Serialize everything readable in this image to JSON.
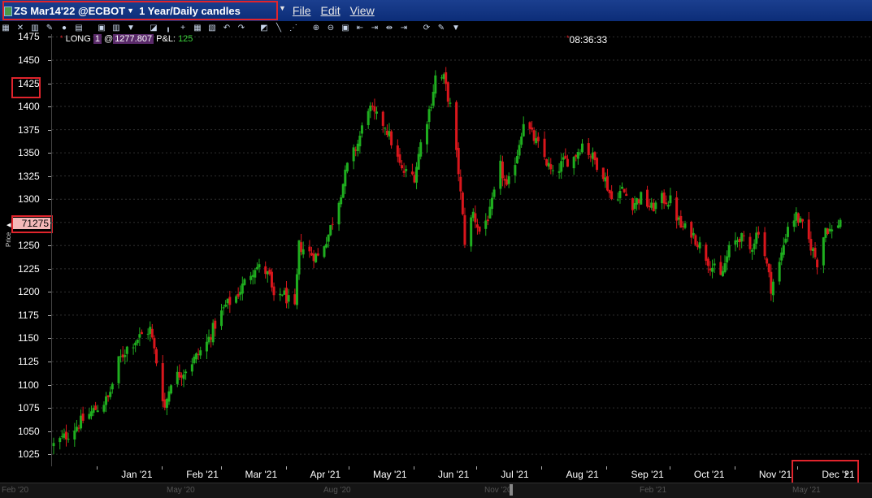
{
  "window": {
    "title": "ZS Mar14'22 @ECBOT",
    "chart_mode": "1 Year/Daily candles",
    "menu": [
      "File",
      "Edit",
      "View"
    ]
  },
  "toolbar": {
    "icons": [
      "chart-type-icon",
      "crosshair-icon",
      "bar-chart-icon",
      "draw-icon",
      "circle-icon",
      "grid-icon",
      "settings-icon",
      "filter-icon",
      "line-icon",
      "pie-icon",
      "add-icon",
      "table-icon",
      "snapshot-icon",
      "undo-icon",
      "redo-icon",
      "ruler-icon",
      "trendline-icon",
      "fibonacci-icon",
      "zoom-in-icon",
      "zoom-out-icon",
      "fit-icon",
      "scroll-left-icon",
      "scroll-start-icon",
      "scroll-right-icon",
      "scroll-end-icon",
      "refresh-icon",
      "wrench-icon",
      "more-icon"
    ]
  },
  "position": {
    "side": "LONG",
    "qty": "1",
    "at": "@",
    "price": "1277.807",
    "pnl_label": "P&L:",
    "pnl_value": "125"
  },
  "clock": "08:36:33",
  "current_price": "71275",
  "y_axis_label": "Price",
  "overview_labels": [
    "Feb '20",
    "May '20",
    "Aug '20",
    "Nov '20",
    "Feb '21",
    "May '21"
  ],
  "colors": {
    "up": "#1fae1f",
    "down": "#d9161c",
    "background": "#000000",
    "highlight": "#e0242c"
  },
  "chart_data": {
    "type": "candlestick",
    "title": "",
    "xlabel": "",
    "ylabel": "Price",
    "ylim": [
      1012,
      1478
    ],
    "yticks": [
      1025,
      1050,
      1075,
      1100,
      1125,
      1150,
      1175,
      1200,
      1225,
      1250,
      1275,
      1300,
      1325,
      1350,
      1375,
      1400,
      1425,
      1450,
      1475
    ],
    "months": [
      "Jan '21",
      "Feb '21",
      "Mar '21",
      "Apr '21",
      "May '21",
      "Jun '21",
      "Jul '21",
      "Aug '21",
      "Sep '21",
      "Oct '21",
      "Nov '21",
      "Dec '21"
    ],
    "x_range": [
      "2020-12-11",
      "2021-12-21"
    ],
    "close_path": [
      [
        "2020-12-11",
        1035
      ],
      [
        "2020-12-17",
        1045
      ],
      [
        "2020-12-24",
        1060
      ],
      [
        "2020-12-30",
        1072
      ],
      [
        "2021-01-06",
        1085
      ],
      [
        "2021-01-11",
        1125
      ],
      [
        "2021-01-15",
        1140
      ],
      [
        "2021-01-20",
        1150
      ],
      [
        "2021-01-26",
        1160
      ],
      [
        "2021-01-29",
        1125
      ],
      [
        "2021-02-02",
        1075
      ],
      [
        "2021-02-05",
        1105
      ],
      [
        "2021-02-11",
        1115
      ],
      [
        "2021-02-17",
        1130
      ],
      [
        "2021-02-22",
        1145
      ],
      [
        "2021-02-26",
        1165
      ],
      [
        "2021-03-03",
        1185
      ],
      [
        "2021-03-08",
        1195
      ],
      [
        "2021-03-12",
        1210
      ],
      [
        "2021-03-17",
        1228
      ],
      [
        "2021-03-22",
        1222
      ],
      [
        "2021-03-24",
        1215
      ],
      [
        "2021-03-26",
        1190
      ],
      [
        "2021-03-30",
        1200
      ],
      [
        "2021-04-05",
        1180
      ],
      [
        "2021-04-07",
        1250
      ],
      [
        "2021-04-12",
        1242
      ],
      [
        "2021-04-16",
        1238
      ],
      [
        "2021-04-21",
        1262
      ],
      [
        "2021-04-26",
        1300
      ],
      [
        "2021-04-30",
        1335
      ],
      [
        "2021-05-05",
        1360
      ],
      [
        "2021-05-10",
        1400
      ],
      [
        "2021-05-13",
        1390
      ],
      [
        "2021-05-18",
        1380
      ],
      [
        "2021-05-21",
        1362
      ],
      [
        "2021-05-26",
        1330
      ],
      [
        "2021-06-01",
        1325
      ],
      [
        "2021-06-04",
        1360
      ],
      [
        "2021-06-09",
        1405
      ],
      [
        "2021-06-11",
        1432
      ],
      [
        "2021-06-15",
        1430
      ],
      [
        "2021-06-18",
        1400
      ],
      [
        "2021-06-22",
        1330
      ],
      [
        "2021-06-25",
        1255
      ],
      [
        "2021-06-29",
        1285
      ],
      [
        "2021-07-02",
        1265
      ],
      [
        "2021-07-07",
        1285
      ],
      [
        "2021-07-12",
        1335
      ],
      [
        "2021-07-15",
        1310
      ],
      [
        "2021-07-20",
        1350
      ],
      [
        "2021-07-23",
        1385
      ],
      [
        "2021-07-28",
        1365
      ],
      [
        "2021-08-02",
        1345
      ],
      [
        "2021-08-06",
        1325
      ],
      [
        "2021-08-11",
        1340
      ],
      [
        "2021-08-16",
        1345
      ],
      [
        "2021-08-20",
        1360
      ],
      [
        "2021-08-25",
        1345
      ],
      [
        "2021-08-30",
        1328
      ],
      [
        "2021-09-03",
        1300
      ],
      [
        "2021-09-08",
        1310
      ],
      [
        "2021-09-13",
        1295
      ],
      [
        "2021-09-17",
        1302
      ],
      [
        "2021-09-22",
        1290
      ],
      [
        "2021-09-27",
        1300
      ],
      [
        "2021-10-01",
        1298
      ],
      [
        "2021-10-06",
        1270
      ],
      [
        "2021-10-11",
        1265
      ],
      [
        "2021-10-15",
        1250
      ],
      [
        "2021-10-20",
        1230
      ],
      [
        "2021-10-25",
        1215
      ],
      [
        "2021-10-29",
        1245
      ],
      [
        "2021-11-03",
        1260
      ],
      [
        "2021-11-08",
        1245
      ],
      [
        "2021-11-12",
        1268
      ],
      [
        "2021-11-15",
        1240
      ],
      [
        "2021-11-18",
        1205
      ],
      [
        "2021-11-22",
        1230
      ],
      [
        "2021-11-26",
        1272
      ],
      [
        "2021-11-30",
        1282
      ],
      [
        "2021-12-03",
        1270
      ],
      [
        "2021-12-07",
        1250
      ],
      [
        "2021-12-10",
        1232
      ],
      [
        "2021-12-14",
        1270
      ],
      [
        "2021-12-17",
        1265
      ],
      [
        "2021-12-21",
        1278
      ]
    ]
  }
}
